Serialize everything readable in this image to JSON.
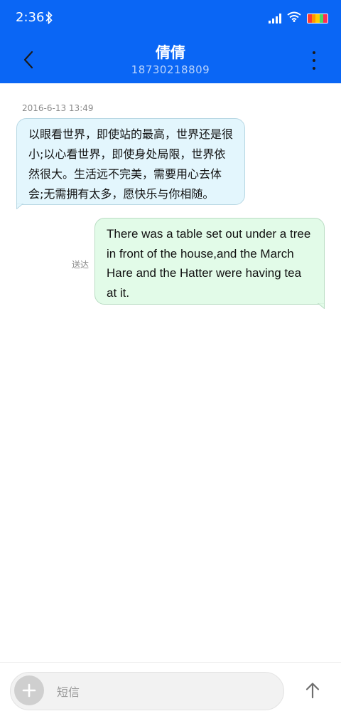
{
  "status_bar": {
    "time": "2:36",
    "icons": [
      "bluetooth-icon",
      "signal-icon",
      "wifi-icon",
      "battery-icon"
    ]
  },
  "header": {
    "contact_name": "倩倩",
    "contact_number": "18730218809",
    "back_icon": "chevron-left-icon",
    "more_icon": "more-vert-icon"
  },
  "conversation": {
    "timestamp": "2016-6-13 13:49",
    "messages": [
      {
        "direction": "incoming",
        "text": "以眼看世界，即使站的最高，世界还是很小;以心看世界，即使身处局限，世界依然很大。生活远不完美，需要用心去体会;无需拥有太多，愿快乐与你相随。"
      },
      {
        "direction": "outgoing",
        "text": "There was a table set out under a tree in front of the house,and the March Hare and the Hatter were having tea at it.",
        "status": "送达"
      }
    ]
  },
  "compose": {
    "placeholder": "短信",
    "value": "",
    "add_icon": "plus-icon",
    "send_icon": "arrow-up-icon"
  },
  "colors": {
    "app_bar": "#0a66f5",
    "incoming_bubble": "#e3f6fd",
    "outgoing_bubble": "#e2fbe8"
  }
}
